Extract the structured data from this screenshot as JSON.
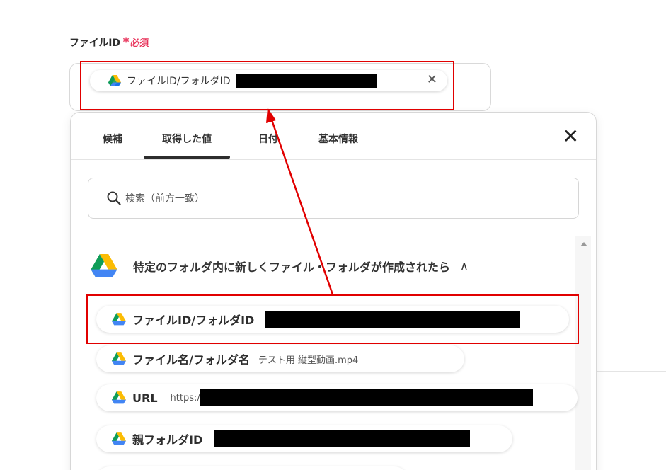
{
  "field": {
    "label": "ファイルID",
    "asterisk": "*",
    "required": "必須"
  },
  "selected_chip": {
    "icon": "google-drive-icon",
    "label": "ファイルID/フォルダID",
    "close": "✕"
  },
  "tabs": [
    {
      "label": "候補"
    },
    {
      "label": "取得した値",
      "active": true
    },
    {
      "label": "日付"
    },
    {
      "label": "基本情報"
    }
  ],
  "panel_close": "✕",
  "search": {
    "placeholder": "検索（前方一致）"
  },
  "group": {
    "title": "特定のフォルダ内に新しくファイル・フォルダが作成されたら",
    "caret": "∧"
  },
  "items": [
    {
      "name": "ファイルID/フォルダID",
      "value": ""
    },
    {
      "name": "ファイル名/フォルダ名",
      "value": "テスト用 縦型動画.mp4"
    },
    {
      "name": "URL",
      "value": "https:/"
    },
    {
      "name": "親フォルダID",
      "value": ""
    }
  ],
  "colors": {
    "required": "#e8325a",
    "highlight": "#e10000",
    "drive_yellow": "#FBBC04",
    "drive_green": "#34A853",
    "drive_blue": "#4285F4"
  }
}
